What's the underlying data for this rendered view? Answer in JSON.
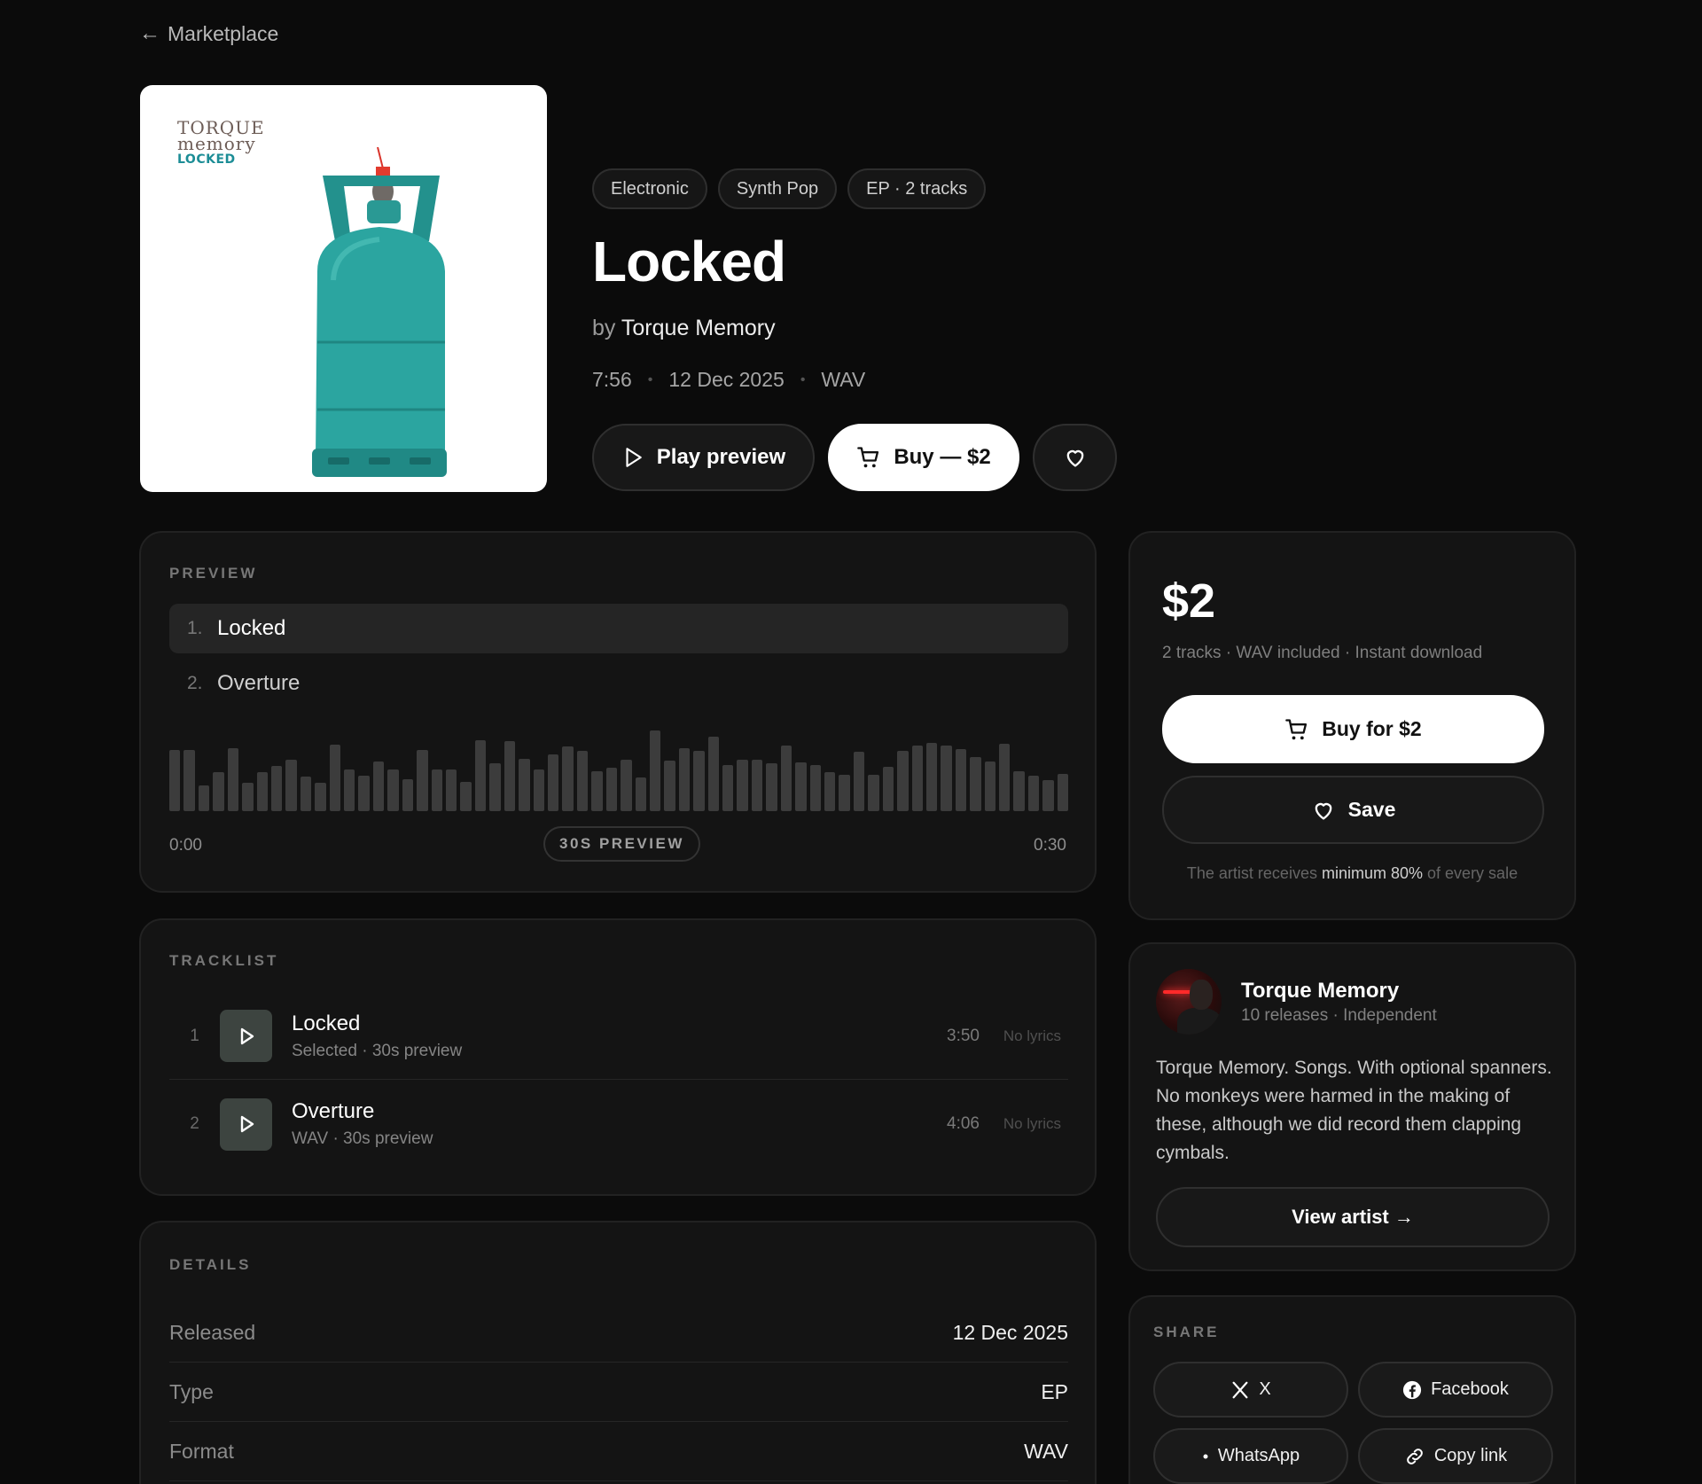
{
  "nav": {
    "back_label": "Marketplace"
  },
  "cover": {
    "logo_line1": "TORQUE",
    "logo_line2": "memory",
    "logo_line3": "LOCKED"
  },
  "release": {
    "tags": [
      "Electronic",
      "Synth Pop",
      "EP · 2 tracks"
    ],
    "title": "Locked",
    "by_prefix": "by",
    "artist": "Torque Memory",
    "duration": "7:56",
    "date": "12 Dec 2025",
    "format": "WAV",
    "dot": "•"
  },
  "actions": {
    "play_label": "Play preview",
    "buy_label": "Buy — $2"
  },
  "preview": {
    "label": "PREVIEW",
    "tracks": [
      {
        "num": "1.",
        "title": "Locked"
      },
      {
        "num": "2.",
        "title": "Overture"
      }
    ],
    "waveform_levels": [
      0.72,
      0.72,
      0.3,
      0.46,
      0.74,
      0.33,
      0.46,
      0.53,
      0.6,
      0.41,
      0.33,
      0.78,
      0.49,
      0.42,
      0.58,
      0.49,
      0.38,
      0.72,
      0.49,
      0.49,
      0.34,
      0.83,
      0.56,
      0.82,
      0.61,
      0.49,
      0.67,
      0.76,
      0.71,
      0.47,
      0.51,
      0.6,
      0.4,
      0.95,
      0.59,
      0.74,
      0.71,
      0.87,
      0.54,
      0.6,
      0.6,
      0.56,
      0.77,
      0.57,
      0.54,
      0.46,
      0.43,
      0.7,
      0.43,
      0.52,
      0.71,
      0.77,
      0.8,
      0.77,
      0.73,
      0.64,
      0.58,
      0.79,
      0.47,
      0.42,
      0.36,
      0.44
    ],
    "time_start": "0:00",
    "time_end": "0:30",
    "pill_label": "30S PREVIEW"
  },
  "tracklist": {
    "label": "TRACKLIST",
    "rows": [
      {
        "num": "1",
        "title": "Locked",
        "sub": "Selected · 30s preview",
        "duration": "3:50",
        "lyrics": "No lyrics"
      },
      {
        "num": "2",
        "title": "Overture",
        "sub": "WAV · 30s preview",
        "duration": "4:06",
        "lyrics": "No lyrics"
      }
    ]
  },
  "details": {
    "label": "DETAILS",
    "rows": [
      {
        "key": "Released",
        "value": "12 Dec 2025"
      },
      {
        "key": "Type",
        "value": "EP"
      },
      {
        "key": "Format",
        "value": "WAV"
      }
    ]
  },
  "purchase": {
    "price": "$2",
    "summary": "2 tracks · WAV included · Instant download",
    "buy_label": "Buy for $2",
    "save_label": "Save",
    "note_prefix": "The artist receives",
    "note_bold": "minimum 80%",
    "note_suffix": "of every sale"
  },
  "artist_card": {
    "name": "Torque Memory",
    "meta": "10 releases · Independent",
    "bio": "Torque Memory. Songs. With optional spanners. No monkeys were harmed in the making of these, although we did record them clapping cymbals.",
    "view_label": "View artist →"
  },
  "share": {
    "label": "SHARE",
    "x_label": "X",
    "facebook_label": "Facebook",
    "whatsapp_label": "WhatsApp",
    "copy_label": "Copy link"
  },
  "colors": {
    "background": "#0b0b0b",
    "card": "#141414",
    "accent_light": "#ffffff",
    "cylinder": "#2aa39f"
  }
}
